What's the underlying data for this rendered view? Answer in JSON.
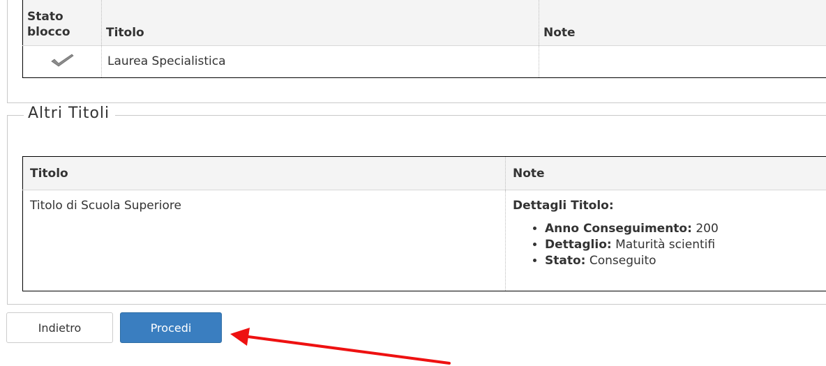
{
  "blocchi_table": {
    "headers": {
      "stato_blocco": "Stato blocco",
      "titolo": "Titolo",
      "note": "Note"
    },
    "rows": [
      {
        "stato_icon": "checkmark-icon",
        "titolo": "Laurea Specialistica",
        "note": ""
      }
    ]
  },
  "altri_titoli": {
    "legend": "Altri Titoli",
    "headers": {
      "titolo": "Titolo",
      "note": "Note"
    },
    "rows": [
      {
        "titolo": "Titolo di Scuola Superiore",
        "note_heading": "Dettagli Titolo:",
        "details": [
          {
            "label": "Anno Conseguimento:",
            "value": "200"
          },
          {
            "label": "Dettaglio:",
            "value": "Maturità scientifi"
          },
          {
            "label": "Stato:",
            "value": "Conseguito"
          }
        ]
      }
    ]
  },
  "buttons": {
    "back": "Indietro",
    "next": "Procedi"
  },
  "colors": {
    "primary_button": "#3a7ec0",
    "annotation_arrow": "#ee1111"
  }
}
